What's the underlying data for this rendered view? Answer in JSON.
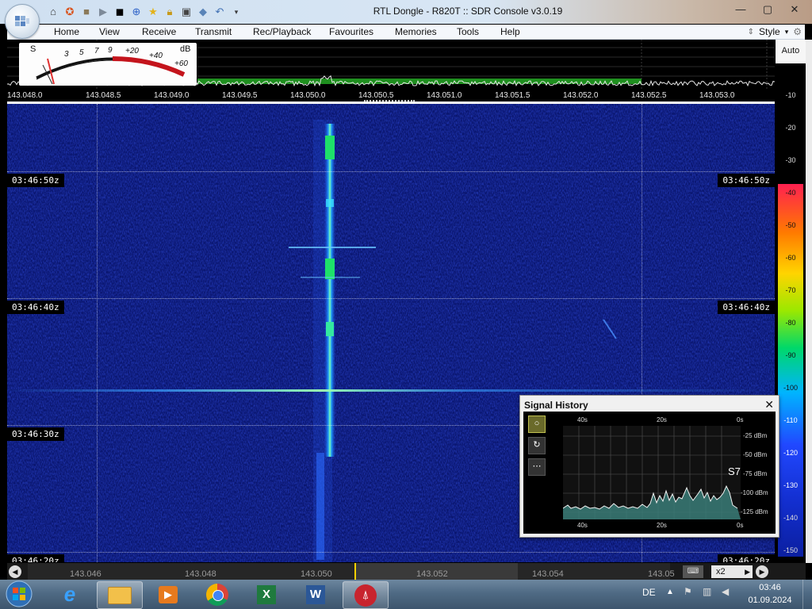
{
  "window": {
    "title": "RTL Dongle - R820T :: SDR Console v3.0.19",
    "controls": [
      "minimize",
      "maximize",
      "close"
    ]
  },
  "quick_access": [
    "home-icon",
    "lifebuoy-icon",
    "folder-icon",
    "play-icon",
    "stop-icon",
    "plus-icon",
    "star-icon",
    "lock-icon",
    "camera-icon",
    "drop-icon",
    "undo-icon",
    "dropdown-icon"
  ],
  "menu": {
    "items": [
      "Home",
      "View",
      "Receive",
      "Transmit",
      "Rec/Playback",
      "Favourites",
      "Memories",
      "Tools",
      "Help"
    ],
    "style_label": "Style"
  },
  "smeter": {
    "s_label": "S",
    "db_label": "dB",
    "scale": [
      "3",
      "5",
      "7",
      "9",
      "+20",
      "+40",
      "+60"
    ]
  },
  "frequency_scale": [
    "143.048.0",
    "143.048.5",
    "143.049.0",
    "143.049.5",
    "143.050.0",
    "143.050.5",
    "143.051.0",
    "143.051.5",
    "143.052.0",
    "143.052.5",
    "143.053.0"
  ],
  "waterfall": {
    "timestamps": [
      "03:46:50z",
      "03:46:40z",
      "03:46:30z",
      "03:46:20z"
    ]
  },
  "db_scale": {
    "auto_label": "Auto",
    "ticks": [
      "-10",
      "-20",
      "-30",
      "-40",
      "-50",
      "-60",
      "-70",
      "-80",
      "-90",
      "-100",
      "-110",
      "-120",
      "-130",
      "-140",
      "-150"
    ]
  },
  "bottom_scale": {
    "labels": [
      "143.046",
      "143.048",
      "143.050",
      "143.052",
      "143.054",
      "143.05"
    ],
    "zoom_label": "x2"
  },
  "signal_history": {
    "title": "Signal History",
    "time_top": [
      "40s",
      "20s",
      "0s"
    ],
    "time_bottom": [
      "40s",
      "20s",
      "0s"
    ],
    "dbm_labels": [
      "-25 dBm",
      "-50 dBm",
      "-75 dBm",
      "-100 dBm",
      "-125 dBm"
    ],
    "s_reading": "S7",
    "tool_glyphs": [
      "○",
      "↻",
      "⋯"
    ]
  },
  "taskbar": {
    "apps": [
      "internet-explorer-icon",
      "file-explorer-icon",
      "media-player-icon",
      "chrome-icon",
      "excel-icon",
      "word-icon",
      "sdr-console-icon"
    ],
    "language": "DE",
    "time": "03:46",
    "date": "01.09.2024"
  },
  "colors": {
    "waterfall_bg": "#0c1a8a",
    "signal": "#00e07a",
    "titlebar": "#d4e4f4",
    "taskbar": "#4f6a84"
  }
}
